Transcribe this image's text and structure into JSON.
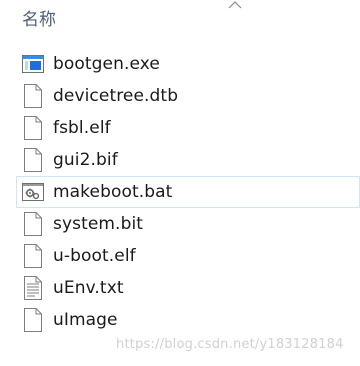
{
  "header": {
    "name_column": "名称"
  },
  "files": [
    {
      "name": "bootgen.exe",
      "icon": "exe-app-icon"
    },
    {
      "name": "devicetree.dtb",
      "icon": "generic-file-icon"
    },
    {
      "name": "fsbl.elf",
      "icon": "generic-file-icon"
    },
    {
      "name": "gui2.bif",
      "icon": "generic-file-icon"
    },
    {
      "name": "makeboot.bat",
      "icon": "batch-file-gear-icon",
      "hovered": true
    },
    {
      "name": "system.bit",
      "icon": "generic-file-icon"
    },
    {
      "name": "u-boot.elf",
      "icon": "generic-file-icon"
    },
    {
      "name": "uEnv.txt",
      "icon": "text-file-icon"
    },
    {
      "name": "uImage",
      "icon": "generic-file-icon"
    }
  ],
  "watermark": "https://blog.csdn.net/y183128184"
}
